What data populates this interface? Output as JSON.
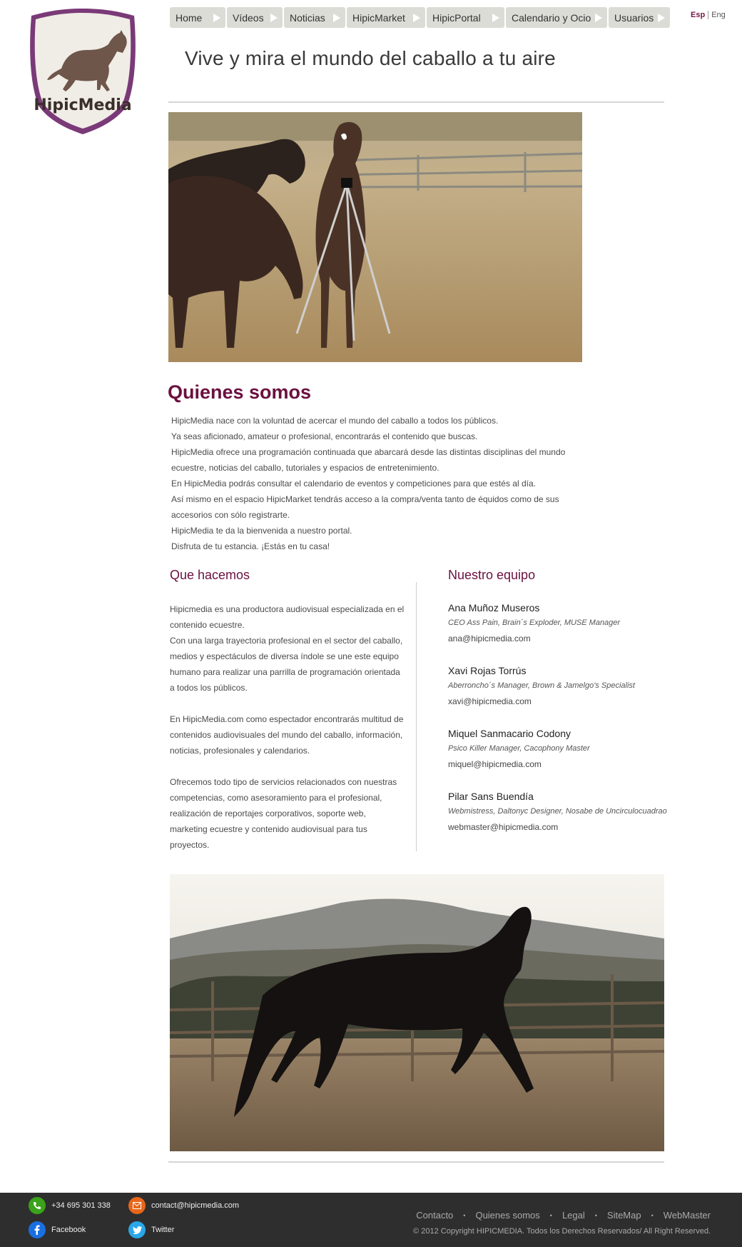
{
  "brand": {
    "name": "HipicMedia",
    "accent": "#6b1040",
    "shield_border": "#7a3a78"
  },
  "nav": {
    "items": [
      {
        "label": "Home"
      },
      {
        "label": "Vídeos"
      },
      {
        "label": "Noticias"
      },
      {
        "label": "HipicMarket"
      },
      {
        "label": "HipicPortal"
      },
      {
        "label": "Calendario y Ocio"
      },
      {
        "label": "Usuarios"
      }
    ]
  },
  "lang": {
    "active": "Esp",
    "other": "Eng"
  },
  "tagline": "Vive y mira el mundo del caballo a tu aire",
  "quienes": {
    "title": "Quienes somos",
    "lines": [
      "HipicMedia nace con la voluntad de acercar el mundo del caballo a todos los públicos.",
      "Ya seas aficionado, amateur o profesional, encontrarás el contenido que buscas.",
      "HipicMedia ofrece una programación continuada que abarcará desde las distintas disciplinas del mundo ecuestre, noticias del caballo, tutoriales y espacios de entretenimiento.",
      "En HipicMedia podrás consultar el calendario de eventos y competiciones para que estés al día.",
      "Así mismo en el espacio HipicMarket tendrás acceso a la compra/venta tanto de équidos como de sus accesorios con sólo registrarte.",
      "HipicMedia te da la bienvenida a nuestro portal.",
      "Disfruta de tu estancia. ¡Estás en tu casa!"
    ]
  },
  "hacemos": {
    "title": "Que hacemos",
    "paragraphs": [
      "Hipicmedia es una productora audiovisual especializada en el contenido ecuestre.\nCon una larga trayectoria profesional en el sector del caballo, medios y espectáculos de diversa índole se une este equipo humano para realizar una parrilla de programación orientada a todos los públicos.",
      "En HipicMedia.com como espectador encontrarás multitud de contenidos audiovisuales del mundo del caballo, información, noticias, profesionales y calendarios.",
      "Ofrecemos todo tipo de servicios relacionados con nuestras competencias, como asesoramiento para el profesional, realización de reportajes corporativos, soporte web, marketing ecuestre y contenido audiovisual para tus proyectos."
    ]
  },
  "equipo": {
    "title": "Nuestro equipo",
    "members": [
      {
        "name": "Ana Muñoz Museros",
        "role": "CEO Ass Pain, Brain´s Exploder, MUSE Manager",
        "email": "ana@hipicmedia.com"
      },
      {
        "name": "Xavi Rojas Torrús",
        "role": "Aberroncho´s Manager, Brown & Jamelgo's Specialist",
        "email": "xavi@hipicmedia.com"
      },
      {
        "name": "Miquel Sanmacario Codony",
        "role": "Psico Killer Manager, Cacophony Master",
        "email": "miquel@hipicmedia.com"
      },
      {
        "name": "Pilar Sans Buendía",
        "role": "Webmistress, Daltonyc Designer, Nosabe de Uncirculocuadrao",
        "email": "webmaster@hipicmedia.com"
      }
    ]
  },
  "footer": {
    "phone": "+34 695 301 338",
    "email": "contact@hipicmedia.com",
    "facebook": "Facebook",
    "twitter": "Twitter",
    "links": [
      "Contacto",
      "Quienes somos",
      "Legal",
      "SiteMap",
      "WebMaster"
    ],
    "copyright": "© 2012 Copyright HIPICMEDIA. Todos los Derechos Reservados/ All Right Reserved.",
    "icon_colors": {
      "phone": "#3aa31b",
      "email": "#e8661a",
      "facebook": "#1a6fe0",
      "twitter": "#2aa7e8"
    }
  }
}
